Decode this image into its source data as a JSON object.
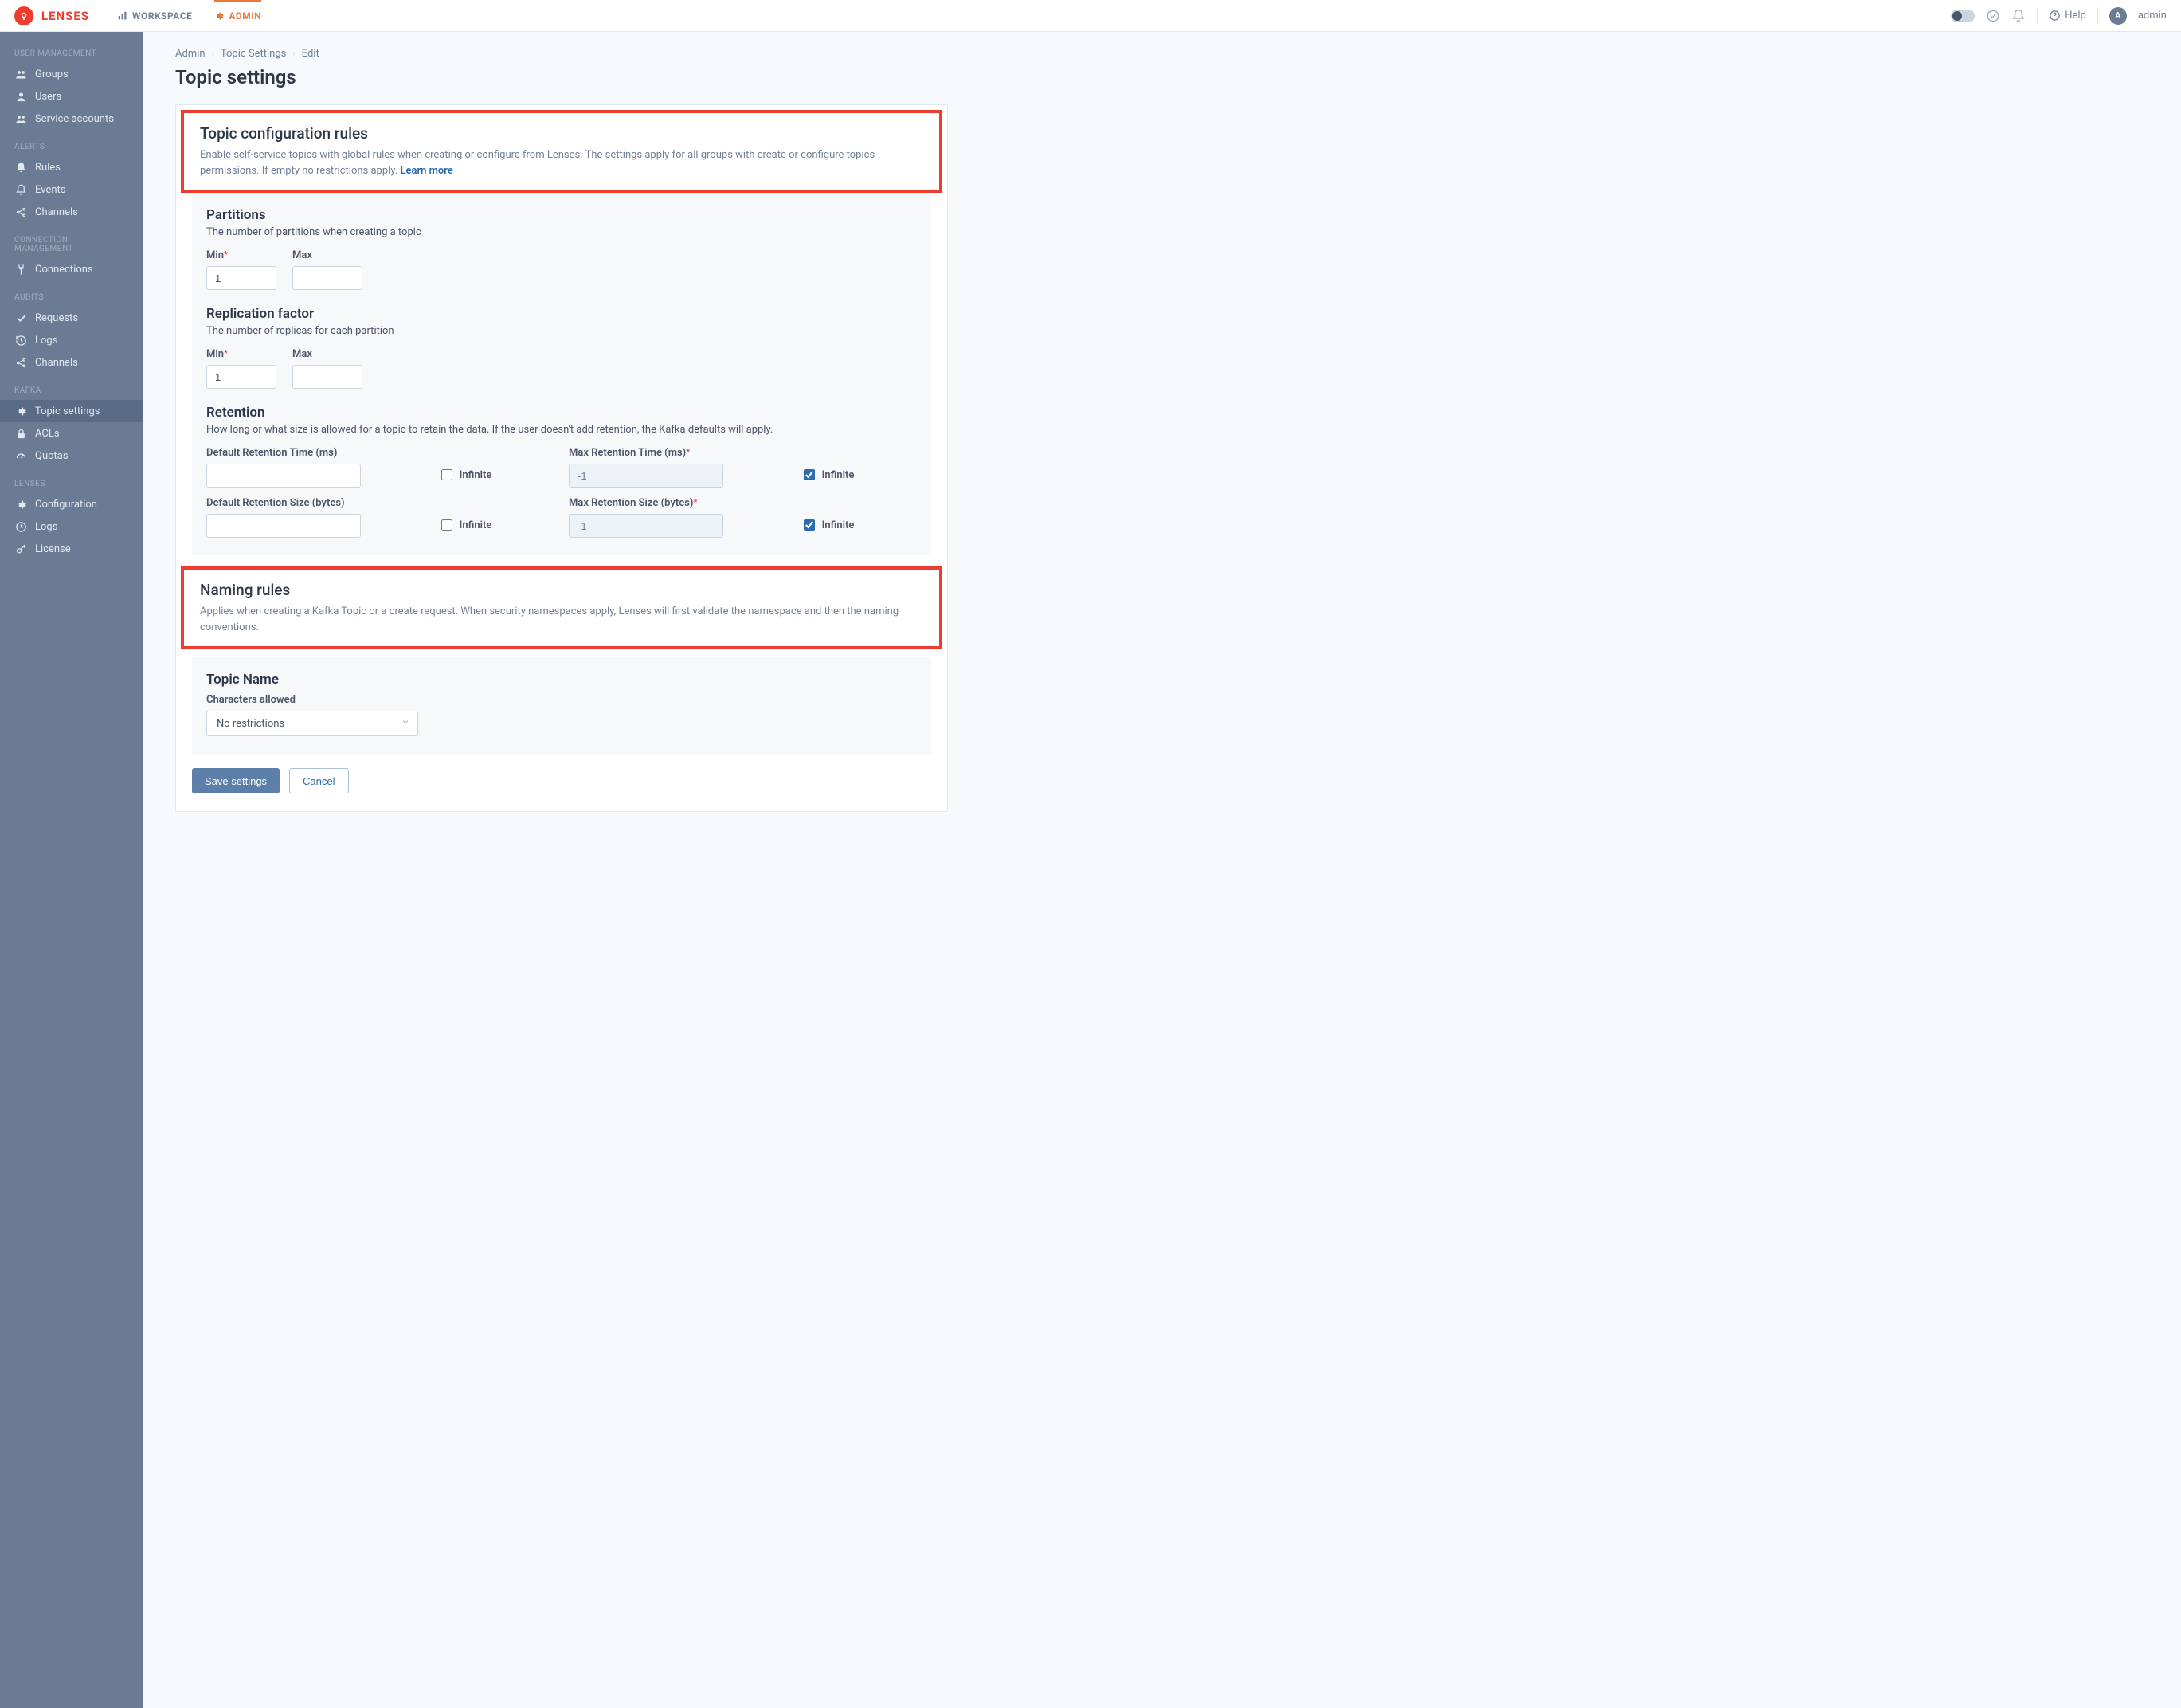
{
  "brand": "LENSES",
  "topnav": {
    "workspace": "WORKSPACE",
    "admin": "ADMIN"
  },
  "topright": {
    "help": "Help",
    "avatar_initial": "A",
    "username": "admin"
  },
  "sidebar": {
    "sections": [
      {
        "title": "USER MANAGEMENT",
        "items": [
          {
            "key": "groups",
            "label": "Groups",
            "icon": "users"
          },
          {
            "key": "users",
            "label": "Users",
            "icon": "user"
          },
          {
            "key": "service-accounts",
            "label": "Service accounts",
            "icon": "users"
          }
        ]
      },
      {
        "title": "ALERTS",
        "items": [
          {
            "key": "alert-rules",
            "label": "Rules",
            "icon": "bell"
          },
          {
            "key": "events",
            "label": "Events",
            "icon": "bell-o"
          },
          {
            "key": "alert-channels",
            "label": "Channels",
            "icon": "share"
          }
        ]
      },
      {
        "title": "CONNECTION MANAGEMENT",
        "items": [
          {
            "key": "connections",
            "label": "Connections",
            "icon": "plug"
          }
        ]
      },
      {
        "title": "AUDITS",
        "items": [
          {
            "key": "requests",
            "label": "Requests",
            "icon": "check"
          },
          {
            "key": "audit-logs",
            "label": "Logs",
            "icon": "history"
          },
          {
            "key": "audit-channels",
            "label": "Channels",
            "icon": "share"
          }
        ]
      },
      {
        "title": "KAFKA",
        "items": [
          {
            "key": "topic-settings",
            "label": "Topic settings",
            "icon": "gear",
            "active": true
          },
          {
            "key": "acls",
            "label": "ACLs",
            "icon": "lock"
          },
          {
            "key": "quotas",
            "label": "Quotas",
            "icon": "gauge"
          }
        ]
      },
      {
        "title": "LENSES",
        "items": [
          {
            "key": "configuration",
            "label": "Configuration",
            "icon": "gear"
          },
          {
            "key": "lenses-logs",
            "label": "Logs",
            "icon": "clock"
          },
          {
            "key": "license",
            "label": "License",
            "icon": "key"
          }
        ]
      }
    ]
  },
  "breadcrumb": [
    "Admin",
    "Topic Settings",
    "Edit"
  ],
  "page_title": "Topic settings",
  "rules": {
    "title": "Topic configuration rules",
    "desc": "Enable self-service topics with global rules when creating or configure from Lenses. The settings apply for all groups with create or configure topics permissions. If empty no restrictions apply. ",
    "learn": "Learn more"
  },
  "partitions": {
    "title": "Partitions",
    "desc": "The number of partitions when creating a topic",
    "min_label": "Min",
    "max_label": "Max",
    "min": "1",
    "max": ""
  },
  "replication": {
    "title": "Replication factor",
    "desc": "The number of replicas for each partition",
    "min_label": "Min",
    "max_label": "Max",
    "min": "1",
    "max": ""
  },
  "retention": {
    "title": "Retention",
    "desc": "How long or what size is allowed for a topic to retain the data. If the user doesn't add retention, the Kafka defaults will apply.",
    "def_time_label": "Default Retention Time (ms)",
    "max_time_label": "Max Retention Time (ms)",
    "def_size_label": "Default Retention Size (bytes)",
    "max_size_label": "Max Retention Size (bytes)",
    "infinite": "Infinite",
    "def_time": "",
    "max_time": "-1",
    "def_size": "",
    "max_size": "-1",
    "def_time_inf": false,
    "max_time_inf": true,
    "def_size_inf": false,
    "max_size_inf": true
  },
  "naming": {
    "title": "Naming rules",
    "desc": "Applies when creating a Kafka Topic or a create request. When security namespaces apply, Lenses will first validate the namespace and then the naming conventions."
  },
  "topic_name": {
    "title": "Topic Name",
    "chars_label": "Characters allowed",
    "chars_value": "No restrictions"
  },
  "actions": {
    "save": "Save settings",
    "cancel": "Cancel"
  }
}
